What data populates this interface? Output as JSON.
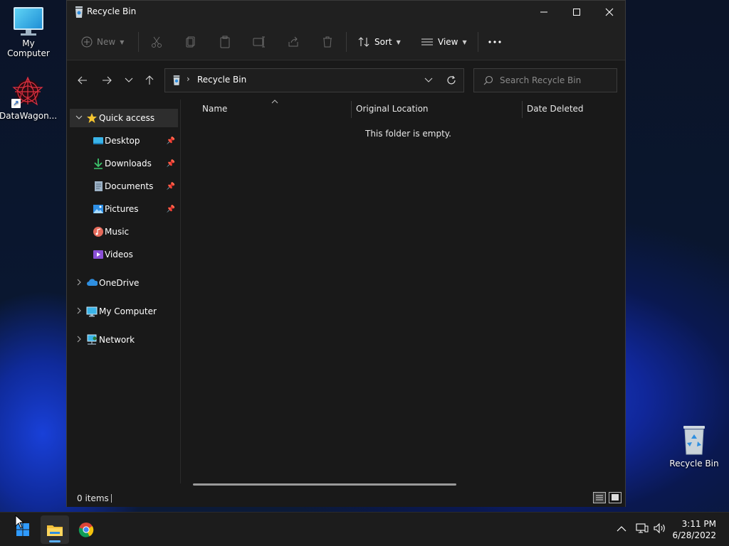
{
  "desktop": {
    "icons": [
      {
        "label": "My Computer"
      },
      {
        "label": "DataWagon..."
      },
      {
        "label": "Recycle Bin"
      }
    ]
  },
  "window": {
    "title": "Recycle Bin",
    "toolbar": {
      "new_label": "New",
      "sort_label": "Sort",
      "view_label": "View"
    },
    "address": {
      "path": "Recycle Bin"
    },
    "search": {
      "placeholder": "Search Recycle Bin"
    },
    "sidebar": {
      "quick_access": "Quick access",
      "items": [
        {
          "label": "Desktop"
        },
        {
          "label": "Downloads"
        },
        {
          "label": "Documents"
        },
        {
          "label": "Pictures"
        },
        {
          "label": "Music"
        },
        {
          "label": "Videos"
        }
      ],
      "roots": [
        {
          "label": "OneDrive"
        },
        {
          "label": "My Computer"
        },
        {
          "label": "Network"
        }
      ]
    },
    "columns": [
      "Name",
      "Original Location",
      "Date Deleted"
    ],
    "empty_message": "This folder is empty.",
    "status": "0 items"
  },
  "taskbar": {
    "time": "3:11 PM",
    "date": "6/28/2022"
  },
  "colors": {
    "accent": "#5ab0ff",
    "window_bg": "#191919",
    "titlebar_bg": "#202020",
    "selected_bg": "#2d2d2d"
  }
}
